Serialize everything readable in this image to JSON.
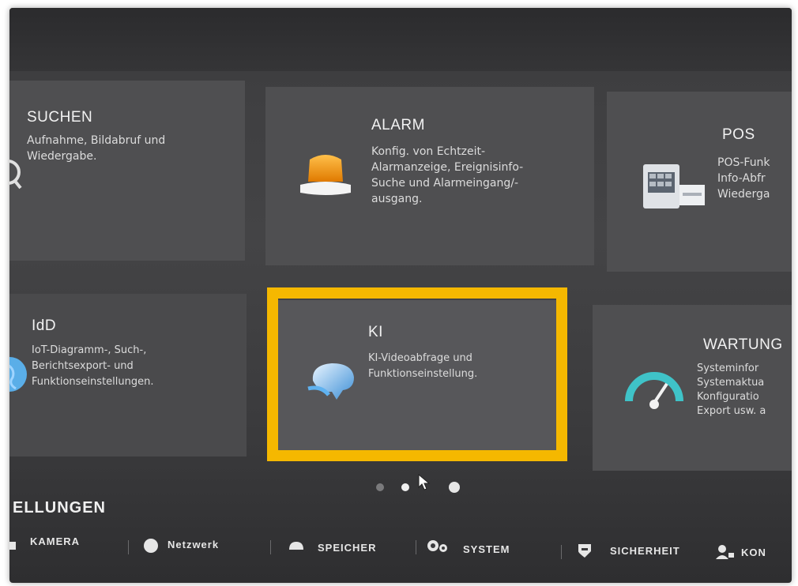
{
  "cards": {
    "suchen": {
      "title": "SUCHEN",
      "desc": "Aufnahme, Bildabruf und Wiedergabe."
    },
    "alarm": {
      "title": "ALARM",
      "desc_lines": [
        "Konfig. von Echtzeit-",
        "Alarmanzeige, Ereignisinfo-",
        "Suche und Alarmeingang/-",
        "ausgang."
      ]
    },
    "pos": {
      "title": "POS",
      "desc_lines": [
        "POS-Funk",
        "Info-Abfr",
        "Wiederga"
      ]
    },
    "idd": {
      "title": "IdD",
      "desc_lines": [
        "IoT-Diagramm-, Such-,",
        "Berichtsexport- und",
        "Funktionseinstellungen."
      ]
    },
    "ki": {
      "title": "KI",
      "desc_lines": [
        "KI-Videoabfrage und",
        "Funktionseinstellung."
      ]
    },
    "wartung": {
      "title": "WARTUNG",
      "desc_lines": [
        "Systeminfor",
        "Systemaktua",
        "Konfiguratio",
        "Export usw. a"
      ]
    }
  },
  "colors": {
    "highlight": "#f5b800",
    "card": "#4f4f51",
    "background": "#3c3c3e"
  },
  "pager": {
    "pages": 3,
    "active_index": 1
  },
  "settings": {
    "title": "ELLUNGEN",
    "nav": [
      "KAMERA",
      "Netzwerk",
      "SPEICHER",
      "SYSTEM",
      "SICHERHEIT",
      "KON"
    ]
  },
  "icons": [
    "search-icon",
    "alarm-light-icon",
    "pos-terminal-icon",
    "globe-icon",
    "ai-brain-icon",
    "gauge-icon",
    "camera-icon",
    "network-icon",
    "storage-icon",
    "system-icon",
    "shield-icon",
    "account-icon"
  ]
}
